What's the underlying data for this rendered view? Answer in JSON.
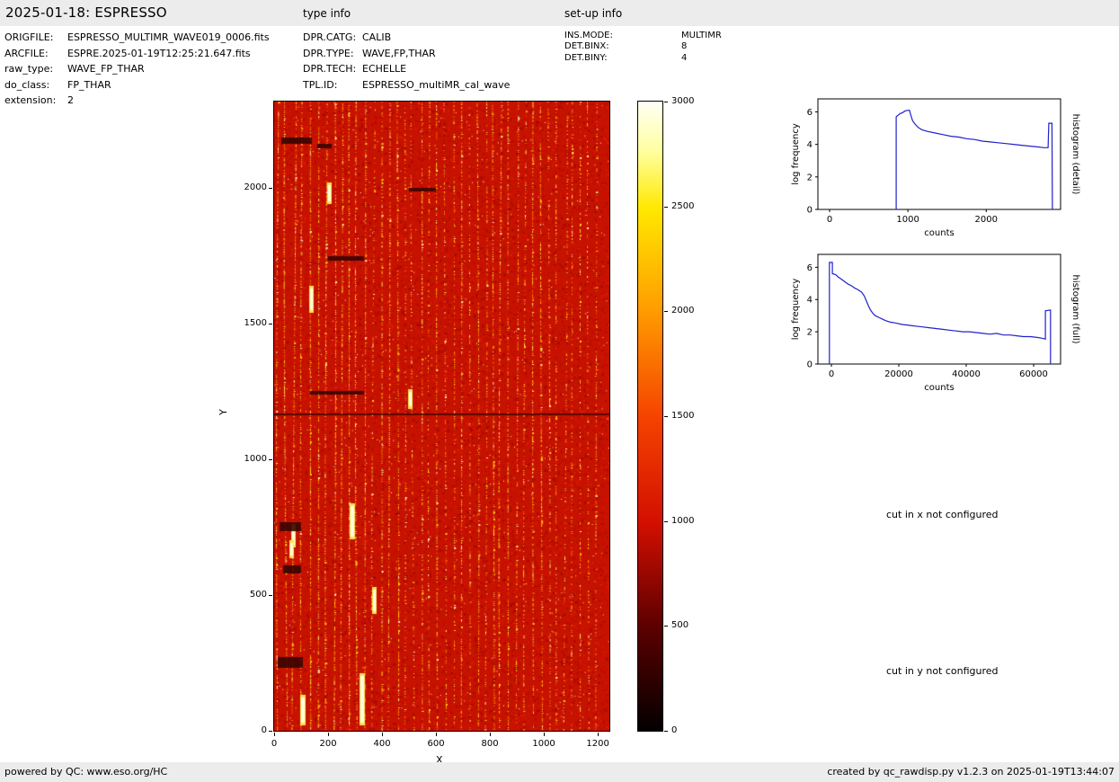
{
  "header": {
    "title": "2025-01-18: ESPRESSO",
    "type_info_label": "type info",
    "setup_info_label": "set-up info"
  },
  "metadata": {
    "left": [
      {
        "label": "ORIGFILE:",
        "value": "ESPRESSO_MULTIMR_WAVE019_0006.fits"
      },
      {
        "label": "ARCFILE:",
        "value": "ESPRE.2025-01-19T12:25:21.647.fits"
      },
      {
        "label": "raw_type:",
        "value": "WAVE_FP_THAR"
      },
      {
        "label": "do_class:",
        "value": "FP_THAR"
      },
      {
        "label": "extension:",
        "value": "2"
      }
    ],
    "middle": [
      {
        "label": "DPR.CATG:",
        "value": "CALIB"
      },
      {
        "label": "DPR.TYPE:",
        "value": "WAVE,FP,THAR"
      },
      {
        "label": "DPR.TECH:",
        "value": "ECHELLE"
      },
      {
        "label": "TPL.ID:",
        "value": "ESPRESSO_multiMR_cal_wave"
      }
    ],
    "right": [
      {
        "label": "INS.MODE:",
        "value": "MULTIMR"
      },
      {
        "label": "DET.BINX:",
        "value": "8"
      },
      {
        "label": "DET.BINY:",
        "value": "4"
      }
    ]
  },
  "messages": {
    "cut_x": "cut in x not configured",
    "cut_y": "cut in y not configured"
  },
  "footer": {
    "left": "powered by QC: www.eso.org/HC",
    "right": "created by qc_rawdisp.py v1.2.3 on 2025-01-19T13:44:07"
  },
  "chart_data": [
    {
      "type": "heatmap",
      "name": "raw frame display",
      "xlabel": "X",
      "ylabel": "Y",
      "xlim": [
        0,
        1243
      ],
      "ylim": [
        0,
        2317
      ],
      "xticks": [
        0,
        200,
        400,
        600,
        800,
        1000,
        1200
      ],
      "yticks": [
        0,
        500,
        1000,
        1500,
        2000
      ],
      "colormap": "hot",
      "colorbar_range": [
        0,
        3000
      ],
      "colorbar_ticks": [
        0,
        500,
        1000,
        1500,
        2000,
        2500,
        3000
      ],
      "description": "ESPRESSO raw echelle calibration frame: ~41 bright vertical FP/ThAr order stripes (yellow-white dotted columns) on red background, dark detector-gap line near y=1170, dark blemishes near left edge"
    },
    {
      "type": "line",
      "name": "histogram (detail)",
      "xlabel": "counts",
      "ylabel": "log frequency",
      "xlim": [
        -150,
        2950
      ],
      "ylim": [
        0,
        6.8
      ],
      "xticks": [
        0,
        1000,
        2000
      ],
      "yticks": [
        0,
        2,
        4,
        6
      ],
      "line_color": "#2020cc",
      "points": [
        [
          850,
          0
        ],
        [
          850,
          5.7
        ],
        [
          900,
          5.9
        ],
        [
          930,
          5.95
        ],
        [
          960,
          6.05
        ],
        [
          1000,
          6.1
        ],
        [
          1020,
          6.1
        ],
        [
          1040,
          5.75
        ],
        [
          1060,
          5.45
        ],
        [
          1090,
          5.25
        ],
        [
          1130,
          5.05
        ],
        [
          1180,
          4.9
        ],
        [
          1250,
          4.8
        ],
        [
          1350,
          4.7
        ],
        [
          1450,
          4.6
        ],
        [
          1550,
          4.5
        ],
        [
          1650,
          4.45
        ],
        [
          1750,
          4.35
        ],
        [
          1850,
          4.3
        ],
        [
          1950,
          4.2
        ],
        [
          2050,
          4.15
        ],
        [
          2150,
          4.1
        ],
        [
          2250,
          4.05
        ],
        [
          2350,
          4.0
        ],
        [
          2450,
          3.95
        ],
        [
          2550,
          3.9
        ],
        [
          2650,
          3.85
        ],
        [
          2740,
          3.8
        ],
        [
          2790,
          3.8
        ],
        [
          2800,
          5.3
        ],
        [
          2840,
          5.3
        ],
        [
          2845,
          0
        ]
      ]
    },
    {
      "type": "line",
      "name": "histogram (full)",
      "xlabel": "counts",
      "ylabel": "log frequency",
      "xlim": [
        -4000,
        68000
      ],
      "ylim": [
        0,
        6.8
      ],
      "xticks": [
        0,
        20000,
        40000,
        60000
      ],
      "yticks": [
        0,
        2,
        4,
        6
      ],
      "line_color": "#2020cc",
      "points": [
        [
          -600,
          0
        ],
        [
          -600,
          6.3
        ],
        [
          300,
          6.3
        ],
        [
          300,
          5.6
        ],
        [
          1200,
          5.55
        ],
        [
          2000,
          5.4
        ],
        [
          3000,
          5.25
        ],
        [
          4000,
          5.1
        ],
        [
          5000,
          4.95
        ],
        [
          6000,
          4.85
        ],
        [
          7000,
          4.7
        ],
        [
          8000,
          4.6
        ],
        [
          9000,
          4.45
        ],
        [
          9800,
          4.2
        ],
        [
          10400,
          3.9
        ],
        [
          11000,
          3.6
        ],
        [
          11600,
          3.35
        ],
        [
          12300,
          3.15
        ],
        [
          13000,
          3.0
        ],
        [
          14000,
          2.9
        ],
        [
          15000,
          2.8
        ],
        [
          16000,
          2.7
        ],
        [
          17500,
          2.6
        ],
        [
          19000,
          2.55
        ],
        [
          21000,
          2.45
        ],
        [
          23000,
          2.4
        ],
        [
          25000,
          2.35
        ],
        [
          27000,
          2.3
        ],
        [
          29000,
          2.25
        ],
        [
          31000,
          2.2
        ],
        [
          33000,
          2.15
        ],
        [
          35000,
          2.1
        ],
        [
          37000,
          2.05
        ],
        [
          39000,
          2.0
        ],
        [
          41000,
          2.0
        ],
        [
          43000,
          1.95
        ],
        [
          45000,
          1.9
        ],
        [
          47000,
          1.85
        ],
        [
          49000,
          1.9
        ],
        [
          51000,
          1.8
        ],
        [
          53000,
          1.8
        ],
        [
          55000,
          1.75
        ],
        [
          57000,
          1.7
        ],
        [
          59000,
          1.7
        ],
        [
          61000,
          1.65
        ],
        [
          62500,
          1.6
        ],
        [
          63500,
          1.55
        ],
        [
          63500,
          3.3
        ],
        [
          65000,
          3.35
        ],
        [
          65000,
          0
        ]
      ]
    }
  ]
}
